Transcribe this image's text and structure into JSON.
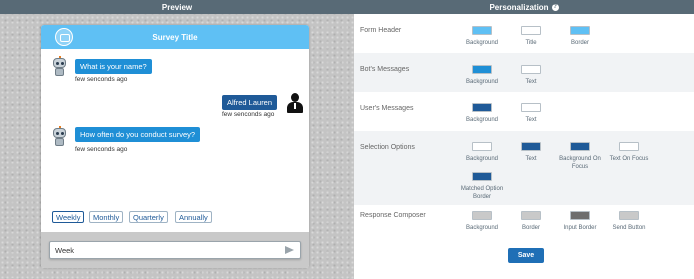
{
  "preview": {
    "header": "Preview",
    "survey_title": "Survey Title",
    "messages": [
      {
        "from": "bot",
        "text": "What is your name?",
        "time": "few senconds ago"
      },
      {
        "from": "user",
        "text": "Alfred Lauren",
        "time": "few senconds ago"
      },
      {
        "from": "bot",
        "text": "How often do you conduct survey?",
        "time": "few senconds ago"
      }
    ],
    "options": [
      "Weekly",
      "Monthly",
      "Quarterly",
      "Annually"
    ],
    "composer": {
      "value": "Week"
    }
  },
  "personalization": {
    "header": "Personalization",
    "sections": [
      {
        "label": "Form Header",
        "swatches": [
          {
            "label": "Background",
            "color": "#5fc0f4"
          },
          {
            "label": "Title",
            "color": "#ffffff"
          },
          {
            "label": "Border",
            "color": "#5fc0f4"
          }
        ]
      },
      {
        "label": "Bot's Messages",
        "swatches": [
          {
            "label": "Background",
            "color": "#1f8fd6"
          },
          {
            "label": "Text",
            "color": "#ffffff"
          }
        ]
      },
      {
        "label": "User's Messages",
        "swatches": [
          {
            "label": "Background",
            "color": "#1f5a98"
          },
          {
            "label": "Text",
            "color": "#ffffff"
          }
        ]
      },
      {
        "label": "Selection Options",
        "swatches": [
          {
            "label": "Background",
            "color": "#ffffff"
          },
          {
            "label": "Text",
            "color": "#1f5a98"
          },
          {
            "label": "Background On Focus",
            "color": "#1f5a98"
          },
          {
            "label": "Text On Focus",
            "color": "#ffffff"
          },
          {
            "label": "Matched Option Border",
            "color": "#1f5a98"
          }
        ]
      },
      {
        "label": "Response Composer",
        "swatches": [
          {
            "label": "Background",
            "color": "#c9c9c9"
          },
          {
            "label": "Border",
            "color": "#c9c9c9"
          },
          {
            "label": "Input Border",
            "color": "#6e6e6e"
          },
          {
            "label": "Send Button",
            "color": "#c9c9c9"
          }
        ]
      }
    ],
    "save_label": "Save"
  }
}
